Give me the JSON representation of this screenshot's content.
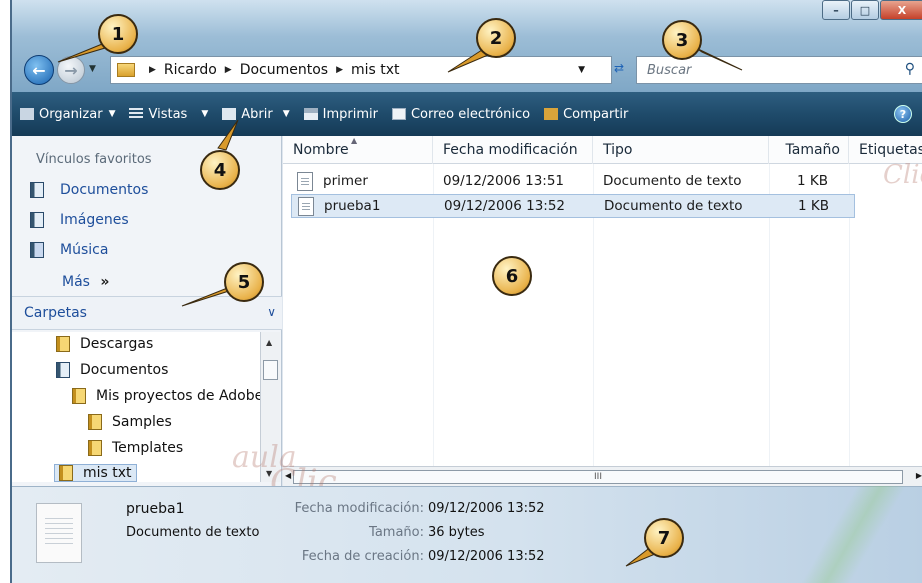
{
  "window": {
    "buttons": {
      "minimize": "–",
      "maximize": "□",
      "close": "X"
    }
  },
  "nav": {
    "back_icon": "back-arrow-icon",
    "forward_icon": "forward-arrow-icon"
  },
  "address": {
    "crumbs": [
      "Ricardo",
      "Documentos",
      "mis txt"
    ]
  },
  "search": {
    "placeholder": "Buscar"
  },
  "toolbar": {
    "organizar": "Organizar",
    "vistas": "Vistas",
    "abrir": "Abrir",
    "imprimir": "Imprimir",
    "correo": "Correo electrónico",
    "compartir": "Compartir",
    "help": "?"
  },
  "sidebar": {
    "favorites_title": "Vínculos favoritos",
    "favorites": [
      "Documentos",
      "Imágenes",
      "Música"
    ],
    "more": "Más",
    "more_chevron": "»",
    "folders_title": "Carpetas",
    "tree": [
      "Descargas",
      "Documentos",
      "Mis proyectos de Adobe",
      "Samples",
      "Templates",
      "mis txt"
    ]
  },
  "filelist": {
    "columns": [
      "Nombre",
      "Fecha modificación",
      "Tipo",
      "Tamaño",
      "Etiquetas"
    ],
    "rows": [
      {
        "name": "primer",
        "date": "09/12/2006 13:51",
        "type": "Documento de texto",
        "size": "1 KB"
      },
      {
        "name": "prueba1",
        "date": "09/12/2006 13:52",
        "type": "Documento de texto",
        "size": "1 KB"
      }
    ],
    "hscroll_grip": "III"
  },
  "details": {
    "name": "prueba1",
    "type": "Documento de texto",
    "label_modified": "Fecha modificación:",
    "value_modified": "09/12/2006 13:52",
    "label_size": "Tamaño:",
    "value_size": "36 bytes",
    "label_created": "Fecha de creación:",
    "value_created": "09/12/2006 13:52"
  },
  "callouts": [
    "1",
    "2",
    "3",
    "4",
    "5",
    "6",
    "7"
  ],
  "watermark": {
    "line1": "aula",
    "line2": "Clic"
  },
  "colors": {
    "toolbar": "#1f4b6b",
    "link": "#1e4e9b",
    "callout": "#e9b24a",
    "selection": "#dde9f5"
  }
}
